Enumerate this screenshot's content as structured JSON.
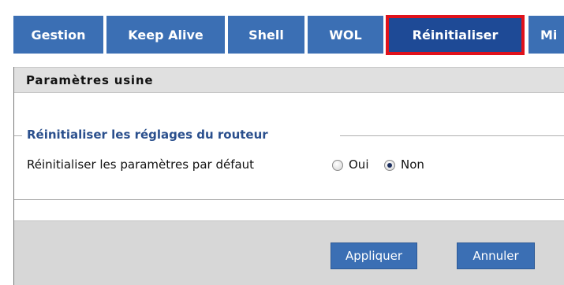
{
  "tabs": [
    {
      "label": "Gestion",
      "active": false
    },
    {
      "label": "Keep Alive",
      "active": false
    },
    {
      "label": "Shell",
      "active": false
    },
    {
      "label": "WOL",
      "active": false
    },
    {
      "label": "Réinitialiser",
      "active": true
    },
    {
      "label": "Mi",
      "active": false
    }
  ],
  "panel": {
    "title": "Paramètres usine",
    "section_title": "Réinitialiser les réglages du routeur",
    "reset_label": "Réinitialiser les paramètres par défaut",
    "options": [
      {
        "label": "Oui",
        "selected": false
      },
      {
        "label": "Non",
        "selected": true
      }
    ]
  },
  "buttons": {
    "apply": "Appliquer",
    "cancel": "Annuler"
  },
  "colors": {
    "tab": "#3b6fb4",
    "tab_active": "#1e4a96",
    "highlight": "#e0121b",
    "legend": "#2a4f8d"
  }
}
